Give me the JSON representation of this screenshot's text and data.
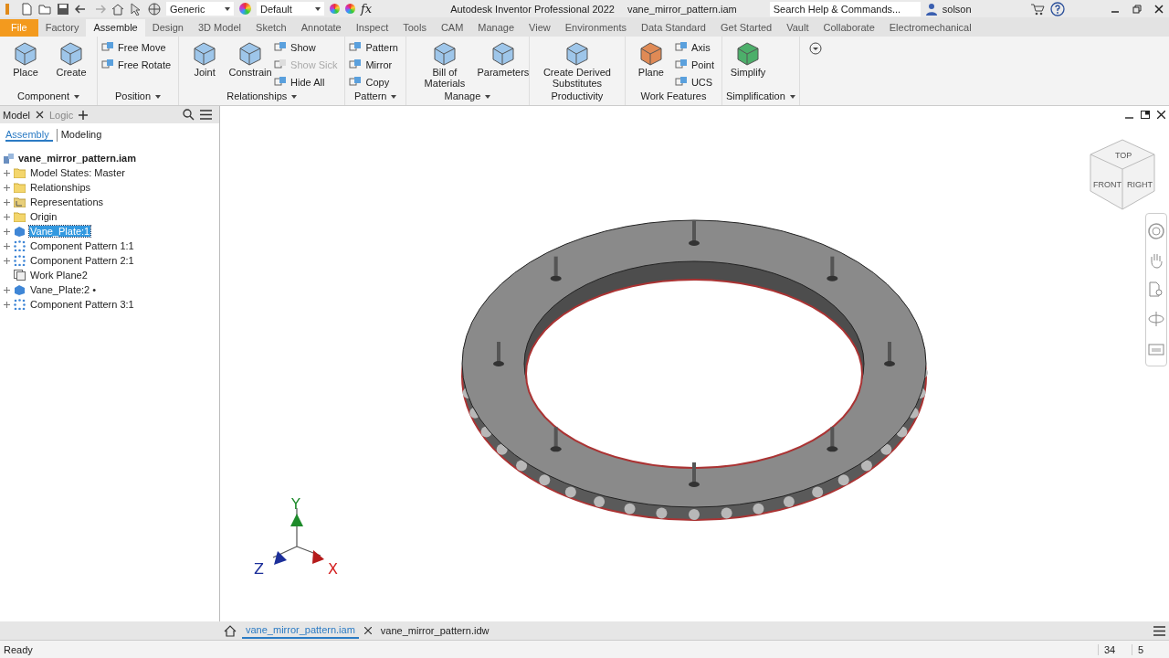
{
  "quick_access": {
    "material": "Generic",
    "appearance": "Default",
    "formula": "fx"
  },
  "title_bar": {
    "app": "Autodesk Inventor Professional 2022",
    "document": "vane_mirror_pattern.iam",
    "search": {
      "placeholder": "Search Help & Commands..."
    },
    "user": "solson"
  },
  "ribbon_tabs": [
    {
      "label": "File",
      "kind": "file",
      "selected": false
    },
    {
      "label": "Factory",
      "kind": "tab",
      "selected": false
    },
    {
      "label": "Assemble",
      "kind": "tab",
      "selected": true
    },
    {
      "label": "Design",
      "kind": "tab",
      "selected": false
    },
    {
      "label": "3D Model",
      "kind": "tab",
      "selected": false
    },
    {
      "label": "Sketch",
      "kind": "tab",
      "selected": false
    },
    {
      "label": "Annotate",
      "kind": "tab",
      "selected": false
    },
    {
      "label": "Inspect",
      "kind": "tab",
      "selected": false
    },
    {
      "label": "Tools",
      "kind": "tab",
      "selected": false
    },
    {
      "label": "CAM",
      "kind": "tab",
      "selected": false
    },
    {
      "label": "Manage",
      "kind": "tab",
      "selected": false
    },
    {
      "label": "View",
      "kind": "tab",
      "selected": false
    },
    {
      "label": "Environments",
      "kind": "tab",
      "selected": false
    },
    {
      "label": "Data Standard",
      "kind": "tab",
      "selected": false
    },
    {
      "label": "Get Started",
      "kind": "tab",
      "selected": false
    },
    {
      "label": "Vault",
      "kind": "tab",
      "selected": false
    },
    {
      "label": "Collaborate",
      "kind": "tab",
      "selected": false
    },
    {
      "label": "Electromechanical",
      "kind": "tab",
      "selected": false
    }
  ],
  "ribbon_panels": [
    {
      "label": "Component",
      "menu": true,
      "tools": [
        {
          "label": "Place",
          "kind": "large",
          "disabled": false
        },
        {
          "label": "Create",
          "kind": "large",
          "disabled": false
        }
      ]
    },
    {
      "label": "Position",
      "menu": true,
      "tools": [
        {
          "label": "Free Move",
          "kind": "small",
          "disabled": false
        },
        {
          "label": "Free Rotate",
          "kind": "small",
          "disabled": false
        }
      ]
    },
    {
      "label": "Relationships",
      "menu": true,
      "tools": [
        {
          "label": "Joint",
          "kind": "large",
          "disabled": false
        },
        {
          "label": "Constrain",
          "kind": "large",
          "disabled": false
        },
        {
          "label": "Show",
          "kind": "small",
          "disabled": false
        },
        {
          "label": "Show Sick",
          "kind": "small",
          "disabled": true
        },
        {
          "label": "Hide All",
          "kind": "small",
          "disabled": false
        }
      ]
    },
    {
      "label": "Pattern",
      "menu": true,
      "tools": [
        {
          "label": "Pattern",
          "kind": "small",
          "disabled": false
        },
        {
          "label": "Mirror",
          "kind": "small",
          "disabled": false
        },
        {
          "label": "Copy",
          "kind": "small",
          "disabled": false
        }
      ]
    },
    {
      "label": "Manage",
      "menu": true,
      "tools": [
        {
          "label": "Bill of Materials",
          "kind": "large",
          "disabled": false
        },
        {
          "label": "Parameters",
          "kind": "large",
          "disabled": false
        }
      ]
    },
    {
      "label": "Productivity",
      "menu": false,
      "tools": [
        {
          "label": "Create Derived Substitutes",
          "kind": "large",
          "disabled": false
        }
      ]
    },
    {
      "label": "Work Features",
      "menu": false,
      "tools": [
        {
          "label": "Plane",
          "kind": "large",
          "disabled": false
        },
        {
          "label": "Axis",
          "kind": "small",
          "disabled": false
        },
        {
          "label": "Point",
          "kind": "small",
          "disabled": false
        },
        {
          "label": "UCS",
          "kind": "small",
          "disabled": false
        }
      ]
    },
    {
      "label": "Simplification",
      "menu": true,
      "tools": [
        {
          "label": "Simplify",
          "kind": "large",
          "disabled": false
        }
      ]
    }
  ],
  "browser": {
    "tabs": [
      {
        "label": "Model",
        "selected": true
      },
      {
        "label": "Logic",
        "selected": false
      }
    ],
    "modes": [
      {
        "label": "Assembly",
        "selected": true
      },
      {
        "label": "Modeling",
        "selected": false
      }
    ],
    "tree": {
      "label": "vane_mirror_pattern.iam",
      "children": [
        {
          "label": "Model States: Master",
          "kind": "folder",
          "collapsed": true,
          "selected": false
        },
        {
          "label": "Relationships",
          "kind": "folder",
          "collapsed": true,
          "selected": false
        },
        {
          "label": "Representations",
          "kind": "representations",
          "collapsed": true,
          "selected": false
        },
        {
          "label": "Origin",
          "kind": "folder",
          "collapsed": true,
          "selected": false
        },
        {
          "label": "Vane_Plate:1",
          "kind": "part",
          "collapsed": true,
          "selected": true
        },
        {
          "label": "Component Pattern 1:1",
          "kind": "pattern",
          "collapsed": true,
          "selected": false
        },
        {
          "label": "Component Pattern 2:1",
          "kind": "pattern",
          "collapsed": true,
          "selected": false
        },
        {
          "label": "Work Plane2",
          "kind": "plane",
          "collapsed": false,
          "selected": false
        },
        {
          "label": "Vane_Plate:2 •",
          "kind": "part",
          "collapsed": true,
          "selected": false
        },
        {
          "label": "Component Pattern 3:1",
          "kind": "pattern",
          "collapsed": true,
          "selected": false
        }
      ]
    }
  },
  "viewport": {
    "view_cube": [
      "TOP",
      "FRONT",
      "RIGHT"
    ],
    "axes": [
      "Y",
      "Z",
      "X"
    ]
  },
  "document_tabs": [
    {
      "label": "vane_mirror_pattern.iam",
      "selected": true
    },
    {
      "label": "vane_mirror_pattern.idw",
      "selected": false
    }
  ],
  "status_bar": {
    "message": "Ready",
    "values": [
      "34",
      "5"
    ]
  }
}
